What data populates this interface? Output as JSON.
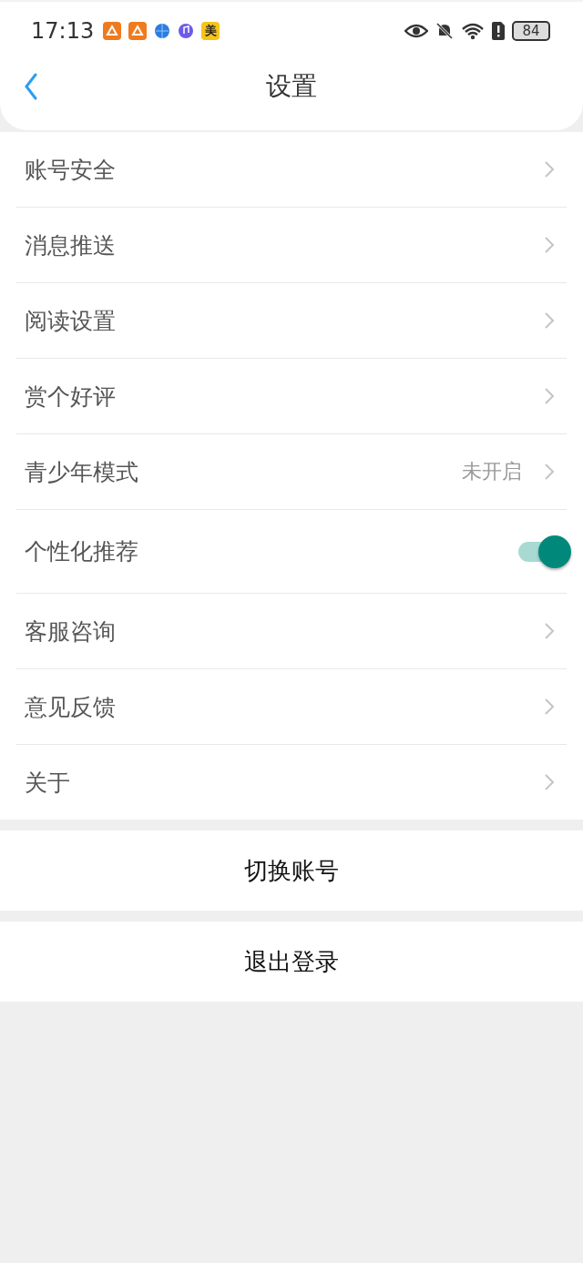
{
  "status_bar": {
    "time": "17:13",
    "app_badge": "美",
    "battery": "84"
  },
  "header": {
    "title": "设置"
  },
  "settings": [
    {
      "kind": "link",
      "label": "账号安全"
    },
    {
      "kind": "link",
      "label": "消息推送"
    },
    {
      "kind": "link",
      "label": "阅读设置"
    },
    {
      "kind": "link",
      "label": "赏个好评"
    },
    {
      "kind": "link",
      "label": "青少年模式",
      "value": "未开启"
    },
    {
      "kind": "toggle",
      "label": "个性化推荐",
      "on": true
    },
    {
      "kind": "link",
      "label": "客服咨询"
    },
    {
      "kind": "link",
      "label": "意见反馈"
    },
    {
      "kind": "link",
      "label": "关于"
    }
  ],
  "buttons": [
    "切换账号",
    "退出登录"
  ]
}
